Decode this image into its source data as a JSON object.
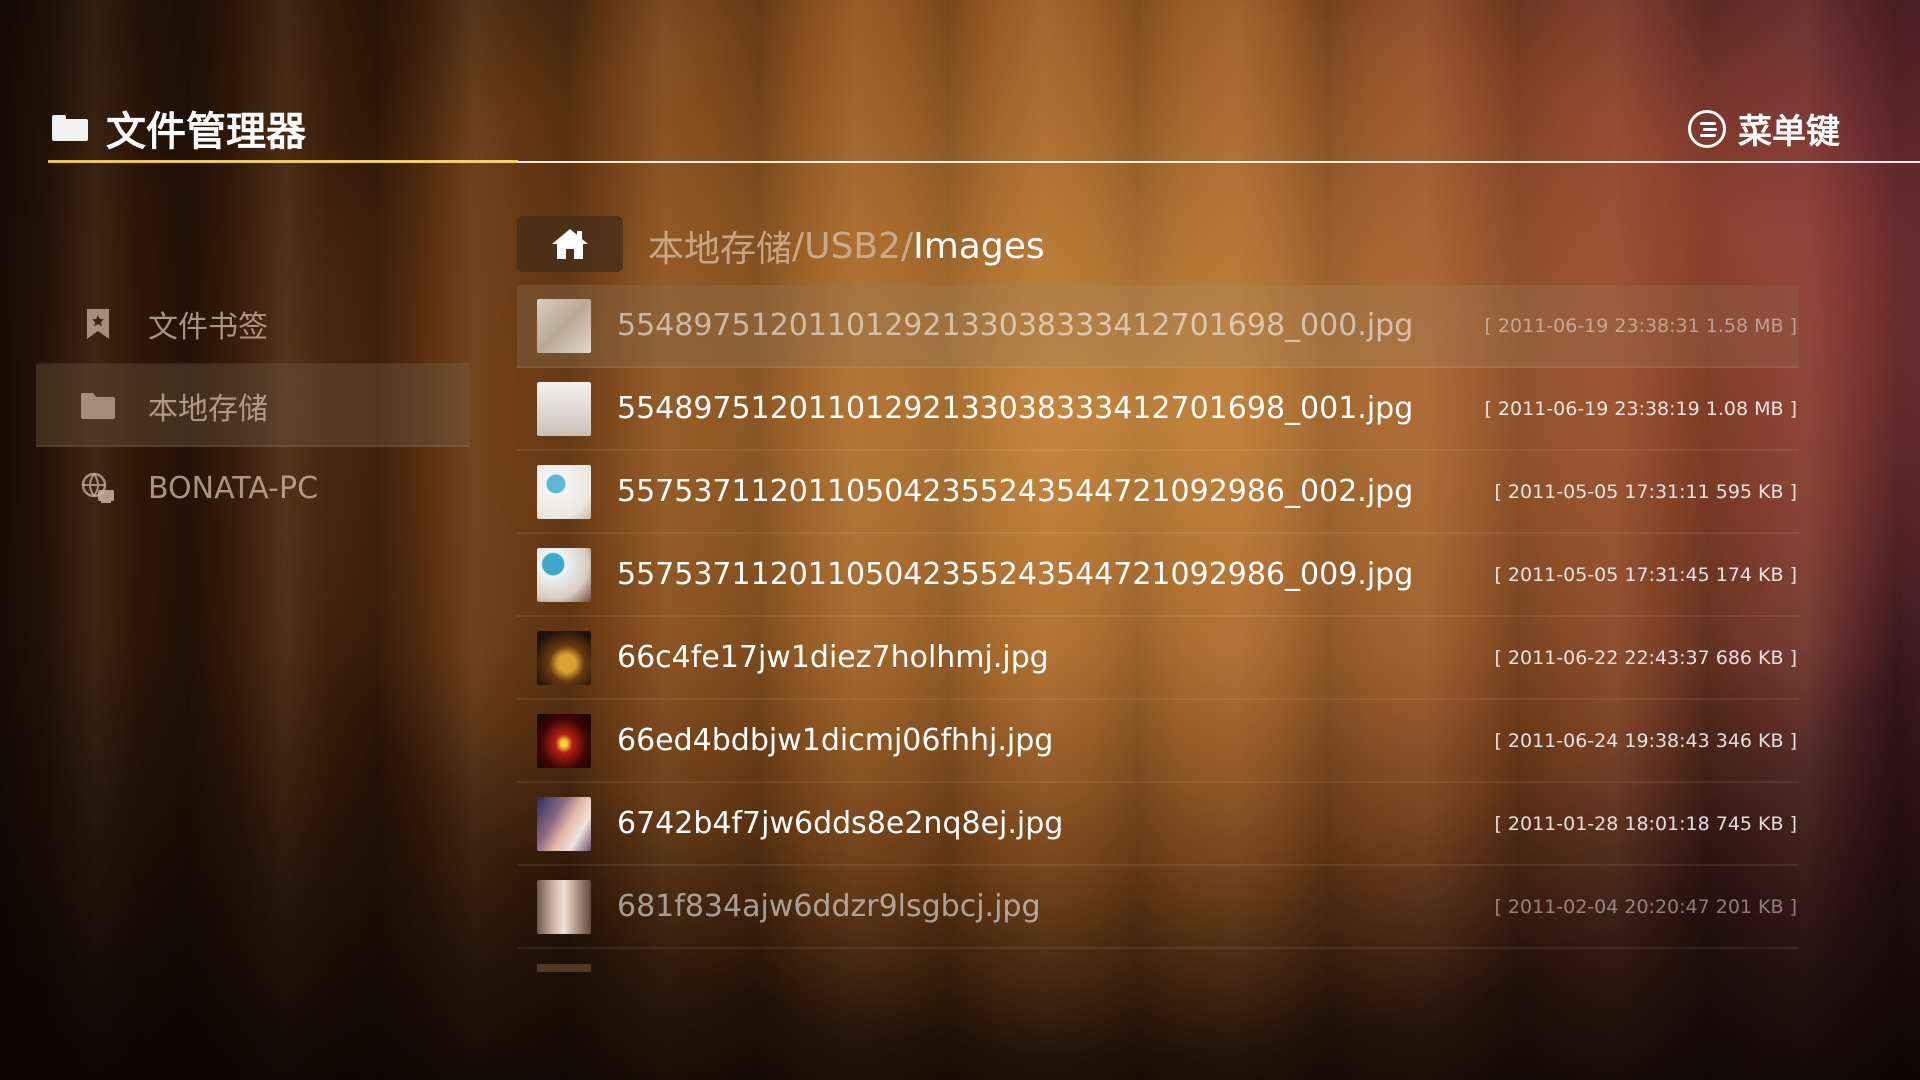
{
  "header": {
    "title": "文件管理器",
    "menu_label": "菜单键"
  },
  "sidebar": {
    "items": [
      {
        "label": "文件书签",
        "icon": "bookmark-icon",
        "active": false
      },
      {
        "label": "本地存储",
        "icon": "folder-icon",
        "active": true
      },
      {
        "label": "BONATA-PC",
        "icon": "network-icon",
        "active": false
      }
    ]
  },
  "path": {
    "part1": "本地存储",
    "sep1": "/",
    "part2": "USB2",
    "sep2": "/",
    "current": "Images"
  },
  "files": [
    {
      "name": "5548975120110129213303833341270​1698_000.jpg",
      "meta": "[ 2011-06-19 23:38:31 1.58 MB ]"
    },
    {
      "name": "554897512011012921330383334127016​98_001.jpg",
      "meta": "[ 2011-06-19 23:38:19 1.08 MB ]"
    },
    {
      "name": "557537112011050423552435447210929​86_002.jpg",
      "meta": "[ 2011-05-05 17:31:11 595 KB ]"
    },
    {
      "name": "557537112011050423552435447210929​86_009.jpg",
      "meta": "[ 2011-05-05 17:31:45 174 KB ]"
    },
    {
      "name": "66c4fe17jw1diez7holhmj.jpg",
      "meta": "[ 2011-06-22 22:43:37 686 KB ]"
    },
    {
      "name": "66ed4bdbjw1dicmj06fhhj.jpg",
      "meta": "[ 2011-06-24 19:38:43 346 KB ]"
    },
    {
      "name": "6742b4f7jw6dds8e2nq8ej.jpg",
      "meta": "[ 2011-01-28 18:01:18 745 KB ]"
    },
    {
      "name": "681f834ajw6ddzr9lsgbcj.jpg",
      "meta": "[ 2011-02-04 20:20:47 201 KB ]"
    }
  ],
  "colors": {
    "accent_underline": "#e8c350"
  }
}
